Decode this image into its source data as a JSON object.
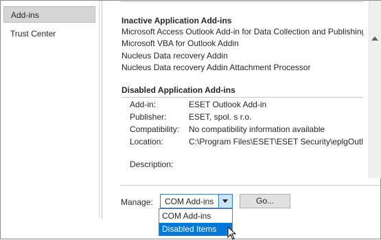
{
  "nav": {
    "items": [
      {
        "label": "Add-ins",
        "selected": true
      },
      {
        "label": "Trust Center",
        "selected": false
      }
    ]
  },
  "inactive": {
    "title": "Inactive Application Add-ins",
    "items": [
      "Microsoft Access Outlook Add-in for Data Collection and Publishing",
      "Microsoft VBA for Outlook Addin",
      "Nucleus Data recovery Addin",
      "Nucleus Data recovery Addin Attachment Processor"
    ]
  },
  "disabled": {
    "title": "Disabled Application Add-ins"
  },
  "details": {
    "addin_label": "Add-in:",
    "addin_value": "ESET Outlook Add-in",
    "publisher_label": "Publisher:",
    "publisher_value": "ESET, spol. s r.o.",
    "compat_label": "Compatibility:",
    "compat_value": "No compatibility information available",
    "location_label": "Location:",
    "location_value": "C:\\Program Files\\ESET\\ESET Security\\eplgOutlook.dll",
    "description_label": "Description:"
  },
  "manage": {
    "label": "Manage:",
    "selected": "COM Add-ins",
    "go_label": "Go...",
    "options": [
      "COM Add-ins",
      "Disabled Items"
    ],
    "highlighted": "Disabled Items"
  },
  "colors": {
    "accent": "#0078d7",
    "selected_nav": "#d6d6d6"
  }
}
